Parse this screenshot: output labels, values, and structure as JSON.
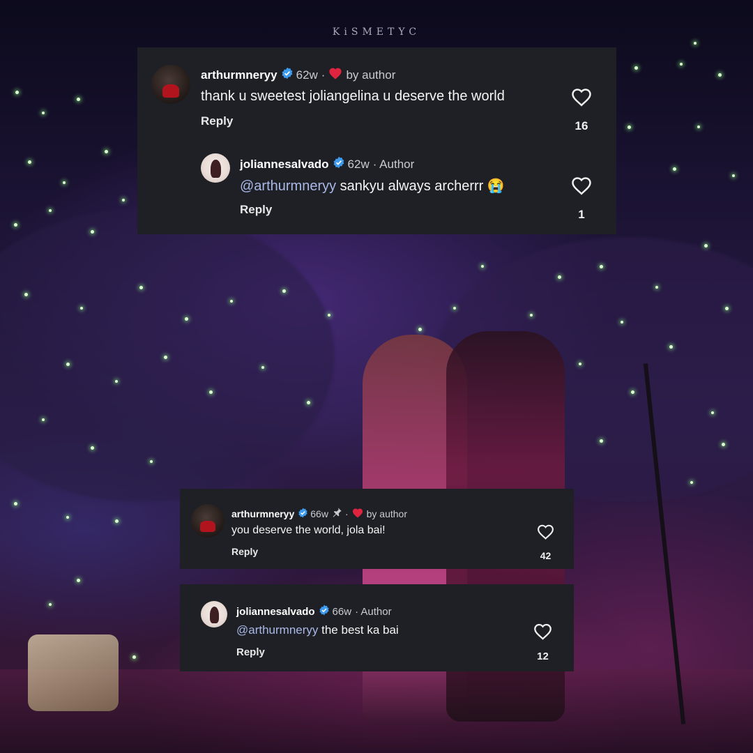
{
  "watermark": "KiSMETYC",
  "comments_top": {
    "parent": {
      "username": "arthurmneryy",
      "age": "62w",
      "separator": "·",
      "liked_by_label": "by author",
      "text": "thank u sweetest joliangelina u deserve the world",
      "reply_label": "Reply",
      "likes": "16"
    },
    "child": {
      "username": "joliannesalvado",
      "age": "62w",
      "author_tag": "· Author",
      "mention": "@arthurmneryy",
      "text": " sankyu always archerrr 😭",
      "reply_label": "Reply",
      "likes": "1"
    }
  },
  "comments_bottom_1": {
    "username": "arthurmneryy",
    "age": "66w",
    "separator": "·",
    "liked_by_label": "by author",
    "text": "you deserve the world, jola bai!",
    "reply_label": "Reply",
    "likes": "42"
  },
  "comments_bottom_2": {
    "username": "joliannesalvado",
    "age": "66w",
    "author_tag": "· Author",
    "mention": "@arthurmneryy",
    "text": " the best ka bai",
    "reply_label": "Reply",
    "likes": "12"
  },
  "colors": {
    "card_bg": "#1e2025",
    "verified": "#3d9bf0",
    "heart_red": "#e0243f",
    "mention": "#a9b8e6",
    "glow_stick": "#b8ff9a"
  }
}
